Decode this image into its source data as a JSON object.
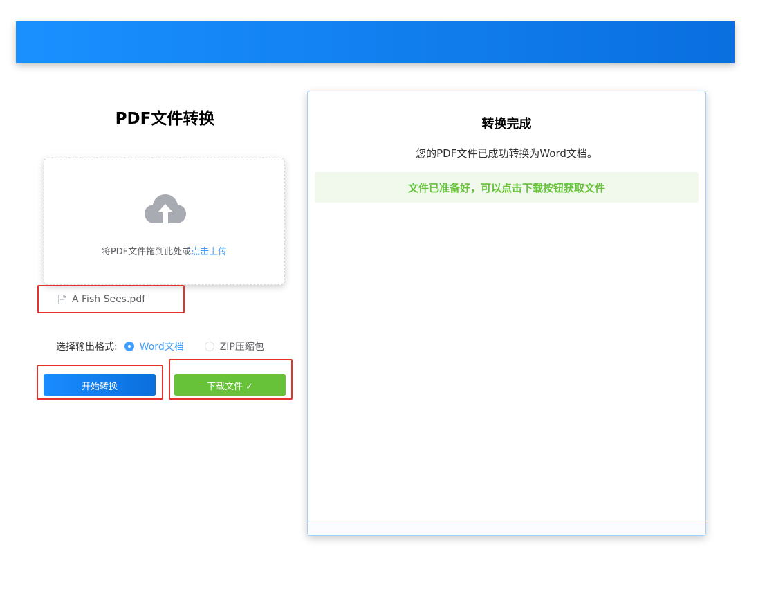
{
  "left": {
    "title": "PDF文件转换",
    "upload": {
      "hint": "将PDF文件拖到此处或",
      "link": "点击上传"
    },
    "file": {
      "name": "A Fish Sees.pdf"
    },
    "format": {
      "label": "选择输出格式:",
      "options": [
        {
          "label": "Word文档",
          "selected": true
        },
        {
          "label": "ZIP压缩包",
          "selected": false
        }
      ]
    },
    "buttons": {
      "start": "开始转换",
      "download": "下载文件 ✓"
    }
  },
  "result": {
    "title": "转换完成",
    "message": "您的PDF文件已成功转换为Word文档。",
    "success": "文件已准备好，可以点击下载按钮获取文件"
  },
  "colors": {
    "primary": "#409eff",
    "success": "#67c23a",
    "highlight": "#e5322d"
  },
  "icons": {
    "upload": "cloud-upload-icon",
    "file": "document-icon"
  }
}
